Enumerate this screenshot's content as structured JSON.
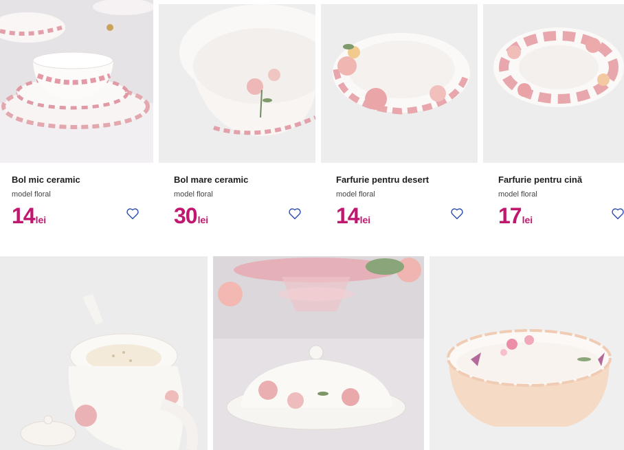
{
  "products_row1": [
    {
      "title": "Bol mic ceramic",
      "subtitle": "model floral",
      "price": "14",
      "currency": "lei"
    },
    {
      "title": "Bol mare ceramic",
      "subtitle": "model floral",
      "price": "30",
      "currency": "lei"
    },
    {
      "title": "Farfurie pentru desert",
      "subtitle": "model floral",
      "price": "14",
      "currency": "lei"
    },
    {
      "title": "Farfurie pentru cină",
      "subtitle": "model floral",
      "price": "17",
      "currency": "lei"
    }
  ],
  "products_row2_images": [
    {
      "image": "teapot-photo"
    },
    {
      "image": "butter-dish-photo"
    },
    {
      "image": "scalloped-bowl-photo"
    }
  ],
  "colors": {
    "price": "#c0186e",
    "heart": "#2d4fb0",
    "image_bg": "#eeeeee"
  },
  "icons": {
    "favorite": "heart-outline-icon"
  }
}
